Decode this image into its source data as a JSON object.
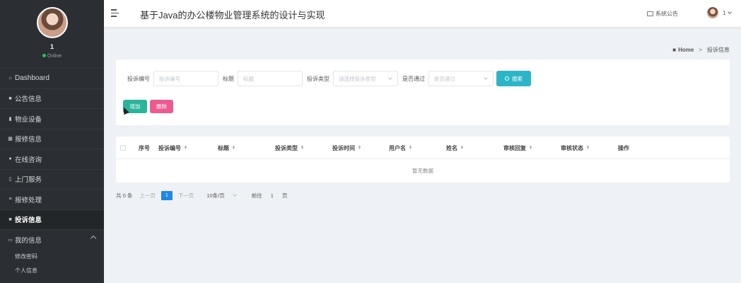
{
  "app": {
    "title": "基于Java的办公楼物业管理系统的设计与实现"
  },
  "sidebar": {
    "user": {
      "name": "1",
      "status": "Online"
    },
    "items": [
      {
        "label": "Dashboard",
        "icon": "home-icon"
      },
      {
        "label": "公告信息",
        "icon": "document-icon"
      },
      {
        "label": "物业设备",
        "icon": "bar-chart-icon"
      },
      {
        "label": "报修信息",
        "icon": "grid-icon"
      },
      {
        "label": "在线咨询",
        "icon": "user-icon"
      },
      {
        "label": "上门服务",
        "icon": "doc-icon"
      },
      {
        "label": "报修处理",
        "icon": "list-icon"
      },
      {
        "label": "投诉信息",
        "icon": "folder-icon"
      },
      {
        "label": "我的信息",
        "icon": "card-icon"
      }
    ],
    "sub_items": [
      {
        "label": "修改密码"
      },
      {
        "label": "个人信息"
      }
    ]
  },
  "header": {
    "notice_label": "系统公告",
    "user_label": "1"
  },
  "breadcrumb": {
    "home": "Home",
    "separator": ">",
    "current": "投诉信息"
  },
  "search": {
    "complaint_no_label": "投诉编号",
    "complaint_no_placeholder": "投诉编号",
    "title_label": "标题",
    "title_placeholder": "标题",
    "type_label": "投诉类型",
    "type_placeholder": "请选择投诉类型",
    "approved_label": "是否通过",
    "approved_placeholder": "是否通过",
    "search_button": "搜索",
    "add_button": "增加",
    "delete_button": "删除"
  },
  "table": {
    "columns": [
      "序号",
      "投诉编号",
      "标题",
      "投诉类型",
      "投诉时间",
      "用户名",
      "姓名",
      "审核回复",
      "审核状态",
      "操作"
    ],
    "empty_text": "暂无数据"
  },
  "pagination": {
    "total": "共 0 条",
    "prev": "上一页",
    "current_page": "1",
    "next": "下一页",
    "page_size": "10条/页",
    "goto_prefix": "前往",
    "goto_value": "1",
    "goto_suffix": "页"
  },
  "colors": {
    "sidebar_bg": "#2b2f33",
    "search_button": "#2cb5c6",
    "add_button": "#2ab59b",
    "delete_button": "#ee5a8f",
    "page_active": "#1e88e5",
    "online_dot": "#22c55e"
  }
}
